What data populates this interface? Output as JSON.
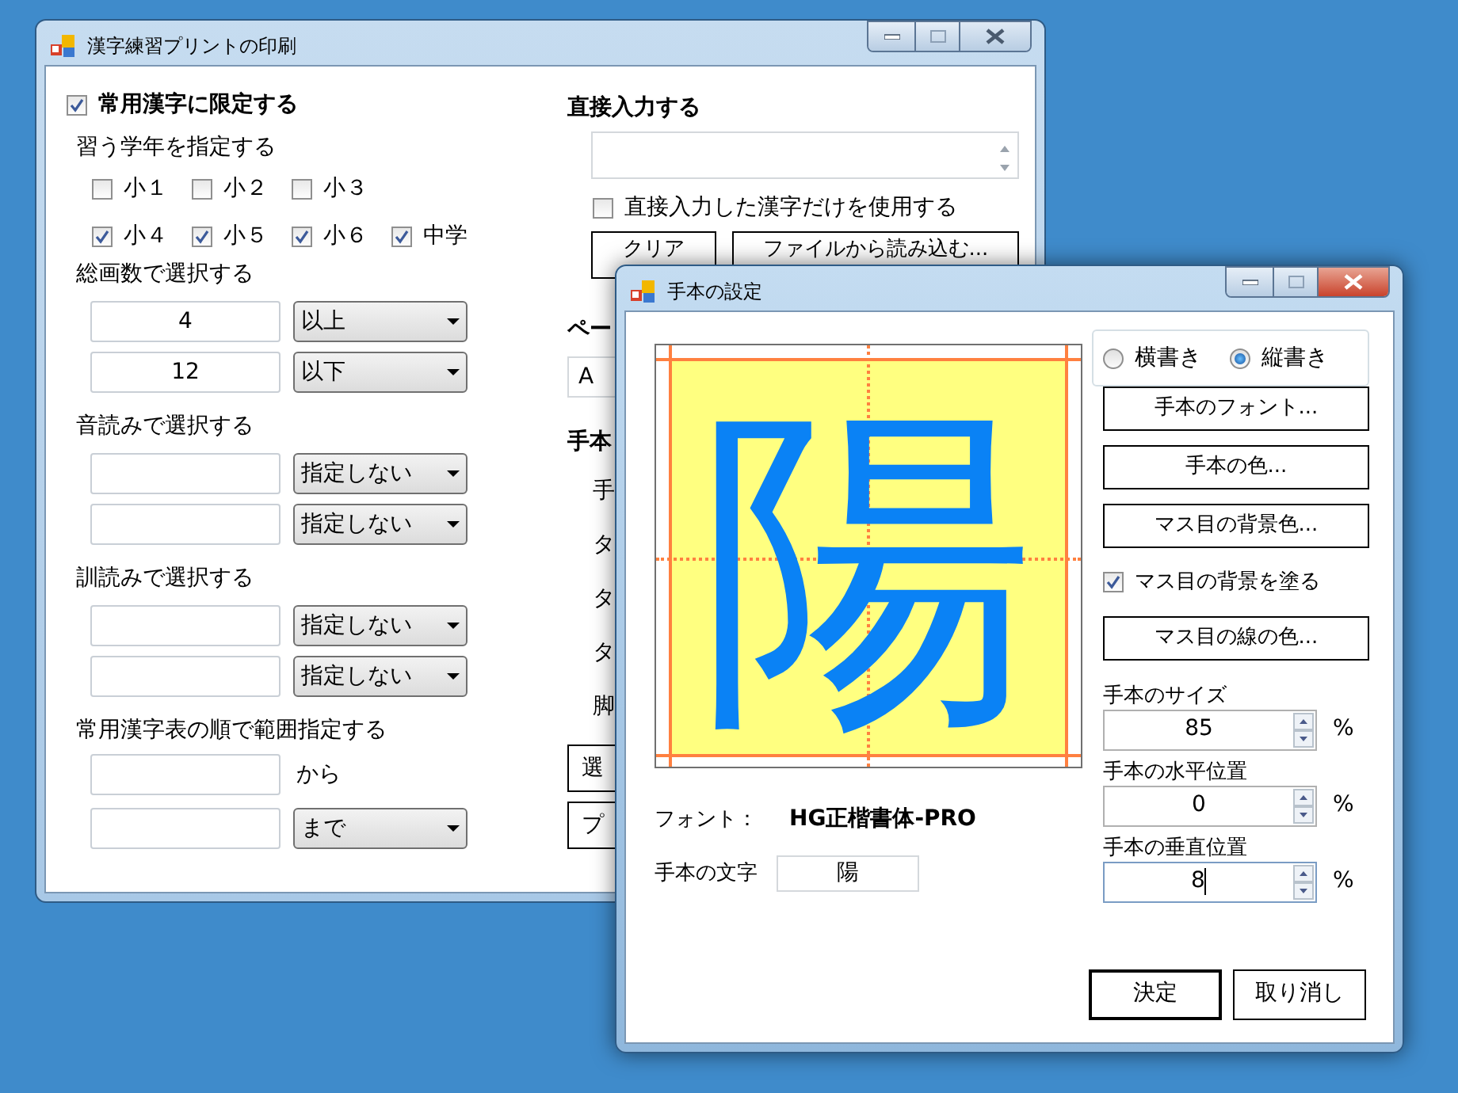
{
  "main_window": {
    "title": "漢字練習プリントの印刷",
    "limit_joyo": {
      "label": "常用漢字に限定する",
      "checked": true
    },
    "grade_section": {
      "label": "習う学年を指定する",
      "rows": [
        [
          {
            "label": "小１",
            "checked": false
          },
          {
            "label": "小２",
            "checked": false
          },
          {
            "label": "小３",
            "checked": false
          }
        ],
        [
          {
            "label": "小４",
            "checked": true
          },
          {
            "label": "小５",
            "checked": true
          },
          {
            "label": "小６",
            "checked": true
          },
          {
            "label": "中学",
            "checked": true
          }
        ]
      ]
    },
    "stroke_section": {
      "label": "総画数で選択する",
      "rows": [
        {
          "value": "4",
          "option": "以上"
        },
        {
          "value": "12",
          "option": "以下"
        }
      ]
    },
    "onyomi_section": {
      "label": "音読みで選択する",
      "rows": [
        {
          "option": "指定しない"
        },
        {
          "option": "指定しない"
        }
      ]
    },
    "kunyomi_section": {
      "label": "訓読みで選択する",
      "rows": [
        {
          "option": "指定しない"
        },
        {
          "option": "指定しない"
        }
      ]
    },
    "range_section": {
      "label": "常用漢字表の順で範囲指定する",
      "from_label": "から",
      "to_option": "まで"
    },
    "direct_input": {
      "heading": "直接入力する",
      "only_direct": {
        "label": "直接入力した漢字だけを使用する",
        "checked": false
      },
      "clear_button": "クリア",
      "load_button": "ファイルから読み込む..."
    },
    "page_heading": "ペー",
    "paper_combo": "A",
    "model_heading": "手本",
    "model_labels": [
      "手",
      "タ",
      "タ",
      "タ",
      "脚"
    ],
    "bottom_buttons": [
      "選",
      "プ"
    ]
  },
  "dialog": {
    "title": "手本の設定",
    "preview": {
      "character": "陽"
    },
    "orientation": [
      {
        "label": "横書き",
        "selected": false
      },
      {
        "label": "縦書き",
        "selected": true
      }
    ],
    "buttons": [
      "手本のフォント...",
      "手本の色...",
      "マス目の背景色..."
    ],
    "fill_background": {
      "label": "マス目の背景を塗る",
      "checked": true
    },
    "line_color_button": "マス目の線の色...",
    "spinners": [
      {
        "label": "手本のサイズ",
        "value": "85",
        "unit": "%",
        "focused": false
      },
      {
        "label": "手本の水平位置",
        "value": "0",
        "unit": "%",
        "focused": false
      },
      {
        "label": "手本の垂直位置",
        "value": "8",
        "unit": "%",
        "focused": true
      }
    ],
    "font": {
      "label": "フォント：",
      "value": "HG正楷書体-PRO"
    },
    "char_field": {
      "label": "手本の文字",
      "value": "陽"
    },
    "ok_button": "決定",
    "cancel_button": "取り消し"
  }
}
